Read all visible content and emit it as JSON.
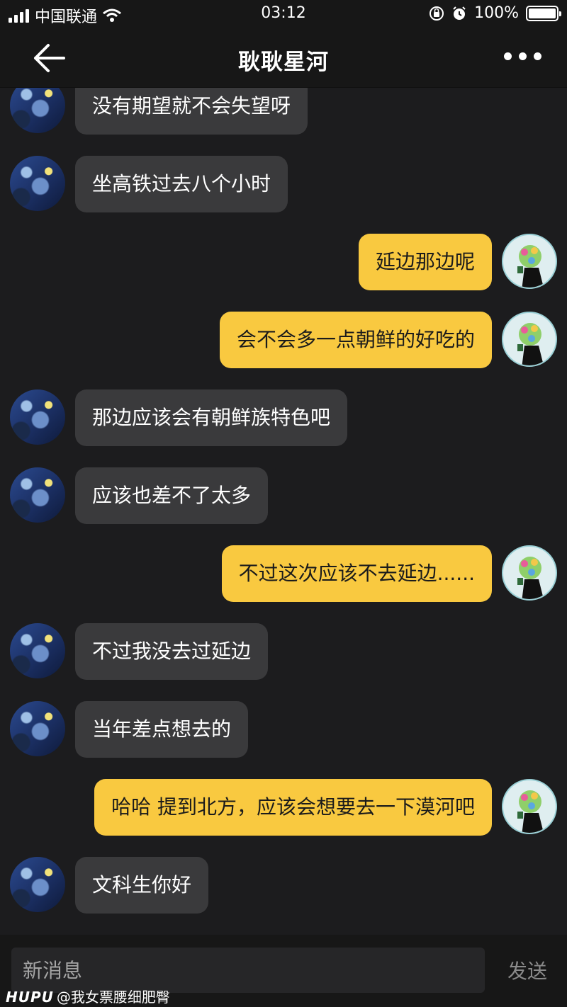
{
  "status_bar": {
    "carrier": "中国联通",
    "time": "03:12",
    "battery": "100%"
  },
  "header": {
    "title": "耿耿星河"
  },
  "messages": [
    {
      "side": "left",
      "text": "没有期望就不会失望呀"
    },
    {
      "side": "left",
      "text": "坐高铁过去八个小时"
    },
    {
      "side": "right",
      "text": "延边那边呢"
    },
    {
      "side": "right",
      "text": "会不会多一点朝鲜的好吃的"
    },
    {
      "side": "left",
      "text": "那边应该会有朝鲜族特色吧"
    },
    {
      "side": "left",
      "text": "应该也差不了太多"
    },
    {
      "side": "right",
      "text": "不过这次应该不去延边......"
    },
    {
      "side": "left",
      "text": "不过我没去过延边"
    },
    {
      "side": "left",
      "text": "当年差点想去的"
    },
    {
      "side": "right",
      "text": "哈哈 提到北方，应该会想要去一下漠河吧"
    },
    {
      "side": "left",
      "text": "文科生你好"
    }
  ],
  "composer": {
    "placeholder": "新消息",
    "send_label": "发送"
  },
  "watermark": {
    "brand": "HUPU",
    "user": "@我女票腰细肥臀"
  }
}
